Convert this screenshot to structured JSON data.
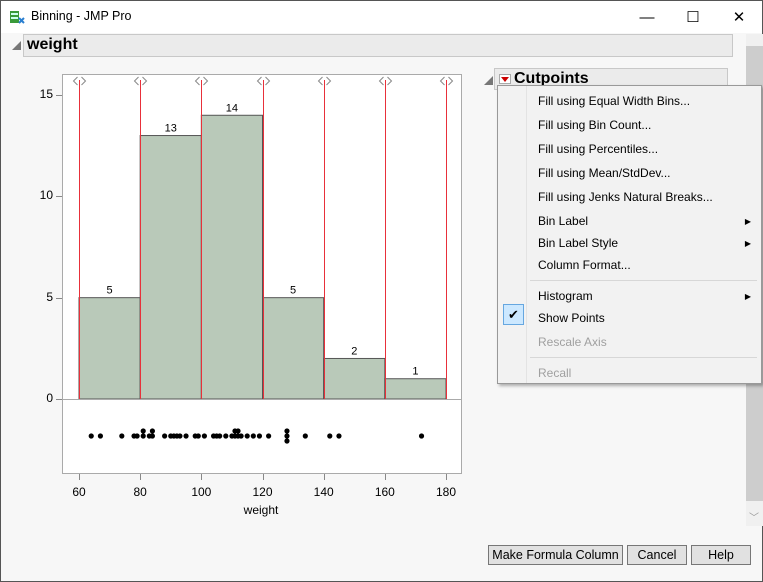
{
  "window": {
    "title": "Binning - JMP Pro",
    "minimize": "—",
    "maximize": "☐",
    "close": "✕"
  },
  "outline_title": "weight",
  "chart_data": {
    "type": "bar",
    "title": "weight",
    "xlabel": "weight",
    "ylabel": "",
    "bin_edges": [
      60,
      80,
      100,
      120,
      140,
      160,
      180
    ],
    "values": [
      5,
      13,
      14,
      5,
      2,
      1
    ],
    "value_labels": [
      "5",
      "13",
      "14",
      "5",
      "2",
      "1"
    ],
    "cutpoints": [
      60,
      80,
      100,
      120,
      140,
      160,
      180
    ],
    "xlim": [
      56,
      185
    ],
    "ylim": [
      0,
      16
    ],
    "xticks": [
      "60",
      "80",
      "100",
      "120",
      "140",
      "160",
      "180"
    ],
    "yticks": [
      "0",
      "5",
      "10",
      "15"
    ],
    "points": [
      64,
      67,
      74,
      78,
      79,
      81,
      81,
      83,
      84,
      84,
      88,
      90,
      91,
      92,
      93,
      95,
      98,
      99,
      101,
      104,
      105,
      106,
      108,
      110,
      111,
      111,
      112,
      112,
      113,
      115,
      117,
      119,
      122,
      128,
      128,
      128,
      134,
      142,
      145,
      172
    ],
    "colors": {
      "bar": "#b9c9b9",
      "cutpoint": "#e8303a"
    }
  },
  "cutpoints_panel": {
    "title": "Cutpoints"
  },
  "menu": {
    "items": [
      {
        "label": "Fill using Equal Width Bins..."
      },
      {
        "label": "Fill using Bin Count..."
      },
      {
        "label": "Fill using Percentiles..."
      },
      {
        "label": "Fill using Mean/StdDev..."
      },
      {
        "label": "Fill using Jenks Natural Breaks..."
      },
      {
        "label": "Bin Label"
      },
      {
        "label": "Bin Label Style"
      },
      {
        "label": "Column Format..."
      },
      {
        "label": "Histogram"
      },
      {
        "label": "Show Points",
        "checked": true
      },
      {
        "label": "Rescale Axis",
        "disabled": true
      },
      {
        "label": "Recall",
        "disabled": true
      }
    ],
    "check": "✔",
    "submenu_arrow": "▶"
  },
  "buttons": {
    "make_formula": "Make Formula Column",
    "cancel": "Cancel",
    "help": "Help"
  }
}
